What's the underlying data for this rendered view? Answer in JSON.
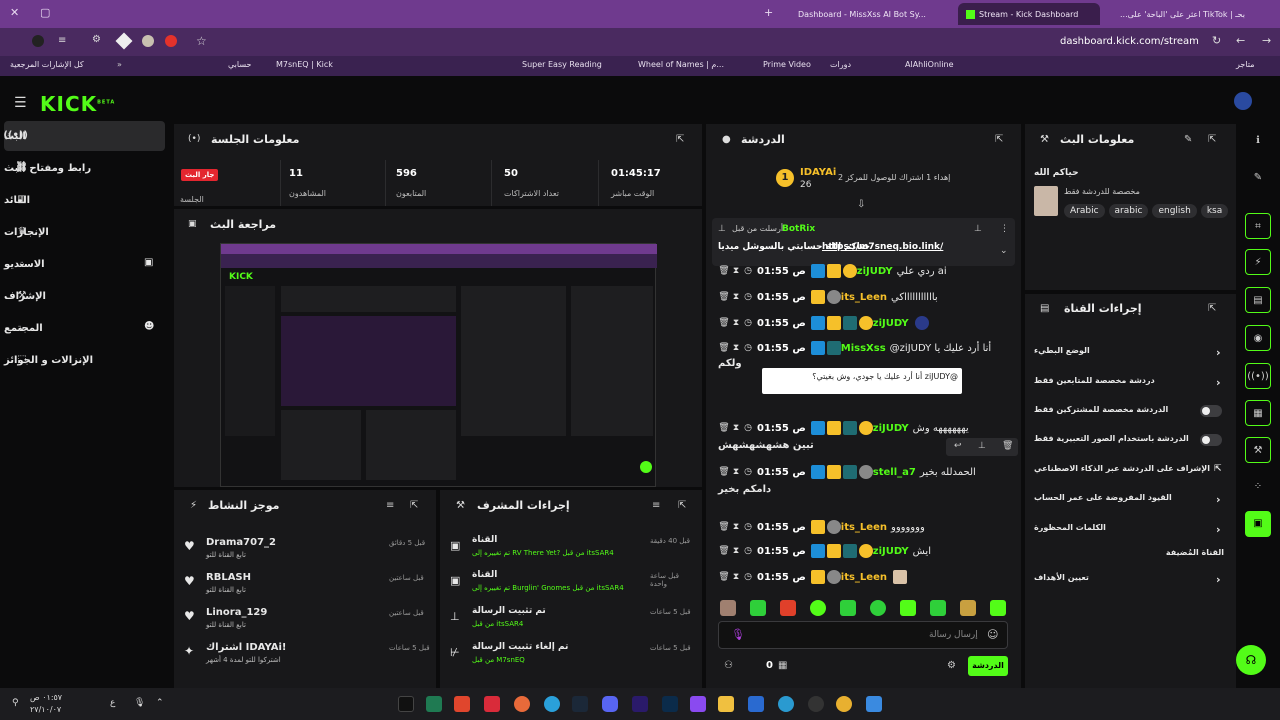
{
  "browser": {
    "tabs": [
      {
        "label": "...اعثر على 'الباحة' على TikTok | بحـ",
        "active": false
      },
      {
        "label": "Stream - Kick Dashboard",
        "active": true
      },
      {
        "label": "Dashboard - MissXss AI Bot Sy...",
        "active": false
      }
    ],
    "url": "dashboard.kick.com/stream",
    "bookmarks": [
      "كل الإشارات المرجعية",
      "حسابي",
      "M7snEQ | Kick",
      "Super Easy Reading",
      "Wheel of Names | م...",
      "Prime Video",
      "دورات",
      "AlAhliOnline",
      "متاجر"
    ]
  },
  "sidebar": {
    "logo": "KICK",
    "logo_sup": "BETA",
    "items": [
      {
        "label": "البث",
        "icon": "broadcast-icon",
        "active": true
      },
      {
        "label": "رابط ومفتاح البث",
        "icon": "link-icon"
      },
      {
        "label": "العائد",
        "icon": "chart-icon"
      },
      {
        "label": "الإنجازات",
        "icon": "trophy-icon"
      },
      {
        "label": "الاستديو",
        "icon": "studio-icon"
      },
      {
        "label": "الإشراف",
        "icon": "hammer-icon"
      },
      {
        "label": "المجتمع",
        "icon": "community-icon"
      },
      {
        "label": "الإنزالات و الجوائز",
        "icon": "gift-icon"
      }
    ]
  },
  "session": {
    "title": "معلومات الجلسة",
    "live_badge": "جار البث",
    "live_label": "الجلسة",
    "stats": [
      {
        "value": "11",
        "label": "المشاهدون"
      },
      {
        "value": "596",
        "label": "المتابعون"
      },
      {
        "value": "50",
        "label": "تعداد الاشتراكات"
      },
      {
        "value": "01:45:17",
        "label": "الوقت مباشر"
      }
    ]
  },
  "preview": {
    "title": "مراجعة البث"
  },
  "activity": {
    "title": "موجز النشاط",
    "items": [
      {
        "name": "Drama707_2",
        "sub": "تابع القناة للتو",
        "time": "قبل 5 دقائق"
      },
      {
        "name": "RBLASH",
        "sub": "تابع القناة للتو",
        "time": "قبل ساعتين"
      },
      {
        "name": "Linora_129",
        "sub": "تابع القناة للتو",
        "time": "قبل ساعتين"
      },
      {
        "name": "اشتراك IDAYAi!",
        "sub": "اشتركوا للتو لمدة 4 أشهر",
        "time": "قبل 5 ساعات"
      }
    ]
  },
  "modactions": {
    "title": "إجراءات المشرف",
    "items": [
      {
        "title": "القناة",
        "sub": "تم تغييره إلى RV There Yet? من قبل itsSAR4",
        "time": "قبل 40 دقيقة"
      },
      {
        "title": "القناة",
        "sub": "تم تغييره إلى Burglin' Gnomes من قبل itsSAR4",
        "time": "قبل ساعة واحدة"
      },
      {
        "title": "تم تثبيت الرسالة",
        "sub": "من قبل itsSAR4",
        "time": "قبل 5 ساعات"
      },
      {
        "title": "تم إلغاء تثبيت الرسالة",
        "sub": "من قبل M7snEQ",
        "time": "قبل 5 ساعات"
      }
    ]
  },
  "chat": {
    "title": "الدردشة",
    "top_user": "IDAYAi",
    "top_count": "26",
    "top_text": "إهداء 1 اشتراك للوصول للمركز 2",
    "pinned_by": "أرسلت من قبل",
    "pinned_user": "BotRix",
    "pinned_text": "حياكم الله حسابتي بالسوشل ميديا",
    "pinned_link": "https://m7sneq.bio.link/",
    "messages": [
      {
        "user": "ziJUDY",
        "time": "01:55 ص",
        "text": "ردي علي ai",
        "color": "#53fc18"
      },
      {
        "user": "its_Leen",
        "time": "01:55 ص",
        "text": "باااااااااااكي",
        "color": "#f6c02a"
      },
      {
        "user": "ziJUDY",
        "time": "01:55 ص",
        "text": "",
        "color": "#53fc18"
      },
      {
        "user": "MissXss",
        "time": "01:55 ص",
        "text": "@ziJUDY أنا أرد عليك يا",
        "color": "#53fc18"
      },
      {
        "user": "ziJUDY",
        "time": "01:55 ص",
        "text": "يههههههه وش",
        "color": "#53fc18"
      },
      {
        "user": "stell_a7",
        "time": "01:55 ص",
        "text": "الحمدلله بخير",
        "color": "#53fc18"
      },
      {
        "user": "its_Leen",
        "time": "01:55 ص",
        "text": "ووووووو",
        "color": "#f6c02a"
      },
      {
        "user": "ziJUDY",
        "time": "01:55 ص",
        "text": "ايش",
        "color": "#53fc18"
      },
      {
        "user": "its_Leen",
        "time": "01:55 ص",
        "text": "",
        "color": "#f6c02a"
      }
    ],
    "extra_line1": "ولكم",
    "extra_line2": "تبين هشهشهشهش",
    "extra_line3": "دامكم بخير",
    "tooltip": "@ziJUDY أنا أرد عليك يا جودي، وش بغيتي؟",
    "placeholder": "إرسال رسالة",
    "send_label": "الدردشة",
    "viewer_count": "0"
  },
  "streaminfo": {
    "title": "معلومات البث",
    "stream_name": "حياكم الله",
    "category": "مخصصة للدردشة فقط",
    "tags": [
      "ksa",
      "english",
      "arabic",
      "Arabic"
    ]
  },
  "channel_actions": {
    "title": "إجراءات القناة",
    "rows": [
      {
        "label": "الوضع البطيء",
        "control": "chevron"
      },
      {
        "label": "دردشة مخصصة للمتابعين فقط",
        "control": "chevron"
      },
      {
        "label": "الدردشة مخصصة للمشتركين فقط",
        "control": "toggle"
      },
      {
        "label": "الدردشة باستخدام الصور التعبيرية فقط",
        "control": "toggle"
      },
      {
        "label": "الإشراف على الدردشة عبر الذكاء الاصطناعي",
        "control": "external"
      },
      {
        "label": "القيود المفروضة على عمر الحساب",
        "control": "chevron"
      },
      {
        "label": "الكلمات المحظورة",
        "control": "chevron"
      },
      {
        "label": "القناة المُضيفة",
        "control": "none"
      },
      {
        "label": "تعيين الأهداف",
        "control": "chevron"
      }
    ]
  },
  "taskbar": {
    "time": "٠١:٥٧ ص",
    "date": "٢٧/١٠/٠٧"
  }
}
